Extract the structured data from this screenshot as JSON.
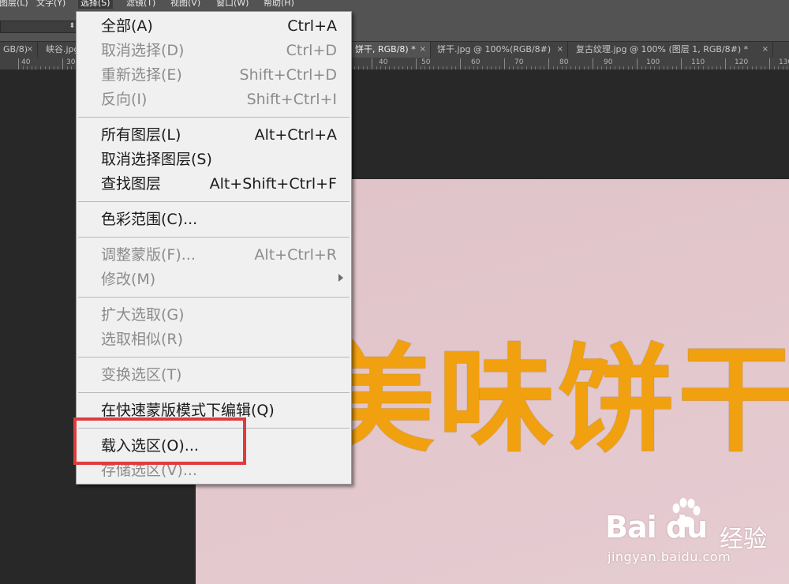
{
  "menubar": {
    "items": [
      {
        "label": "图层(L)"
      },
      {
        "label": "文字(Y)"
      },
      {
        "label": "选择(S)"
      },
      {
        "label": "滤镜(T)"
      },
      {
        "label": "视图(V)"
      },
      {
        "label": "窗口(W)"
      },
      {
        "label": "帮助(H)"
      }
    ]
  },
  "tabs": [
    {
      "label": "GB/8)",
      "close": "×"
    },
    {
      "label": "峡谷.jpg",
      "close": ""
    },
    {
      "label": "饼干, RGB/8) *",
      "close": "×"
    },
    {
      "label": "饼干.jpg @ 100%(RGB/8#)",
      "close": "×"
    },
    {
      "label": "复古纹理.jpg @ 100% (图层 1, RGB/8#) *",
      "close": "×"
    }
  ],
  "ruler": {
    "labels": [
      "40",
      "30",
      "40",
      "50",
      "60",
      "70",
      "80",
      "90",
      "100",
      "110",
      "120",
      "130"
    ]
  },
  "document": {
    "text": "美味饼干"
  },
  "select_menu": {
    "items": [
      {
        "label": "全部(A)",
        "shortcut": "Ctrl+A",
        "enabled": true
      },
      {
        "label": "取消选择(D)",
        "shortcut": "Ctrl+D",
        "enabled": false
      },
      {
        "label": "重新选择(E)",
        "shortcut": "Shift+Ctrl+D",
        "enabled": false
      },
      {
        "label": "反向(I)",
        "shortcut": "Shift+Ctrl+I",
        "enabled": false
      },
      {
        "label": "所有图层(L)",
        "shortcut": "Alt+Ctrl+A",
        "enabled": true
      },
      {
        "label": "取消选择图层(S)",
        "shortcut": "",
        "enabled": true
      },
      {
        "label": "查找图层",
        "shortcut": "Alt+Shift+Ctrl+F",
        "enabled": true
      },
      {
        "label": "色彩范围(C)...",
        "shortcut": "",
        "enabled": true
      },
      {
        "label": "调整蒙版(F)...",
        "shortcut": "Alt+Ctrl+R",
        "enabled": false
      },
      {
        "label": "修改(M)",
        "shortcut": "",
        "enabled": false
      },
      {
        "label": "扩大选取(G)",
        "shortcut": "",
        "enabled": false
      },
      {
        "label": "选取相似(R)",
        "shortcut": "",
        "enabled": false
      },
      {
        "label": "变换选区(T)",
        "shortcut": "",
        "enabled": false
      },
      {
        "label": "在快速蒙版模式下编辑(Q)",
        "shortcut": "",
        "enabled": true
      },
      {
        "label": "载入选区(O)...",
        "shortcut": "",
        "enabled": true
      },
      {
        "label": "存储选区(V)...",
        "shortcut": "",
        "enabled": false
      }
    ]
  },
  "watermark": {
    "brand": "Bai du",
    "name": "经验",
    "url": "jingyan.baidu.com"
  },
  "colors": {
    "menu_bg": "#f0f0f0",
    "highlight_border": "#e03a3d",
    "document_text": "#f1a10f",
    "document_bg": "#e2c6cc"
  }
}
